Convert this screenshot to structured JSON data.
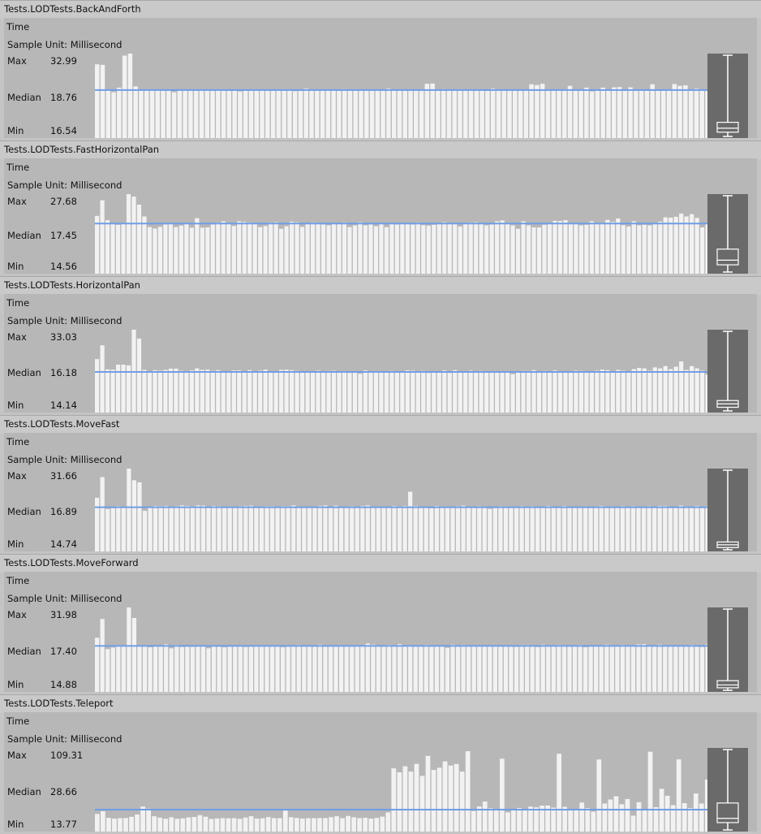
{
  "colors": {
    "bar": "#f2f2f2",
    "median_line": "#6f9ee6",
    "panel": "#b7b7b7",
    "header": "#c9c9c9",
    "boxplot_bg": "#6a6a6a",
    "boxplot_stroke": "#ffffff"
  },
  "tests": [
    {
      "name": "Tests.LODTests.BackAndForth",
      "metric": "Time",
      "sample_unit_label": "Sample Unit: Millisecond",
      "max_label": "Max",
      "max_value": "32.99",
      "median_label": "Median",
      "median_value": "18.76",
      "min_label": "Min",
      "min_value": "16.54"
    },
    {
      "name": "Tests.LODTests.FastHorizontalPan",
      "metric": "Time",
      "sample_unit_label": "Sample Unit: Millisecond",
      "max_label": "Max",
      "max_value": "27.68",
      "median_label": "Median",
      "median_value": "17.45",
      "min_label": "Min",
      "min_value": "14.56"
    },
    {
      "name": "Tests.LODTests.HorizontalPan",
      "metric": "Time",
      "sample_unit_label": "Sample Unit: Millisecond",
      "max_label": "Max",
      "max_value": "33.03",
      "median_label": "Median",
      "median_value": "16.18",
      "min_label": "Min",
      "min_value": "14.14"
    },
    {
      "name": "Tests.LODTests.MoveFast",
      "metric": "Time",
      "sample_unit_label": "Sample Unit: Millisecond",
      "max_label": "Max",
      "max_value": "31.66",
      "median_label": "Median",
      "median_value": "16.89",
      "min_label": "Min",
      "min_value": "14.74"
    },
    {
      "name": "Tests.LODTests.MoveForward",
      "metric": "Time",
      "sample_unit_label": "Sample Unit: Millisecond",
      "max_label": "Max",
      "max_value": "31.98",
      "median_label": "Median",
      "median_value": "17.40",
      "min_label": "Min",
      "min_value": "14.88"
    },
    {
      "name": "Tests.LODTests.Teleport",
      "metric": "Time",
      "sample_unit_label": "Sample Unit: Millisecond",
      "max_label": "Max",
      "max_value": "109.31",
      "median_label": "Median",
      "median_value": "28.66",
      "min_label": "Min",
      "min_value": "13.77"
    }
  ],
  "chart_data": [
    {
      "type": "bar",
      "ylim": [
        0,
        32.99
      ],
      "median": 18.76,
      "min": 16.54,
      "max": 32.99,
      "boxplot": {
        "min": 16.54,
        "q1": 17.4,
        "median": 18.2,
        "q3": 19.4,
        "max": 32.99
      },
      "values": [
        28.8,
        28.6,
        18.8,
        17.9,
        19.7,
        32.2,
        32.99,
        20.2,
        18.7,
        18.6,
        18.8,
        18.6,
        18.6,
        18.6,
        17.9,
        18.7,
        18.6,
        18.8,
        18.6,
        18.8,
        19.0,
        18.5,
        18.6,
        18.9,
        18.4,
        18.7,
        18.2,
        19.0,
        18.6,
        18.8,
        18.9,
        18.6,
        18.5,
        18.8,
        18.9,
        18.8,
        18.3,
        18.7,
        19.3,
        18.6,
        18.6,
        18.8,
        18.6,
        18.7,
        18.4,
        19.1,
        18.6,
        18.9,
        18.6,
        18.8,
        18.6,
        18.8,
        18.6,
        19.3,
        18.5,
        18.6,
        18.9,
        18.8,
        18.6,
        18.8,
        21.2,
        21.3,
        18.5,
        19.1,
        18.6,
        18.8,
        18.6,
        18.8,
        18.7,
        18.9,
        18.6,
        18.4,
        19.3,
        18.7,
        18.6,
        18.8,
        18.6,
        18.8,
        18.7,
        21.0,
        20.7,
        21.2,
        18.5,
        19.0,
        18.8,
        18.8,
        20.4,
        18.6,
        18.7,
        19.7,
        18.2,
        18.8,
        19.7,
        18.6,
        19.8,
        19.9,
        18.8,
        19.8,
        18.6,
        18.8,
        18.4,
        21.0,
        18.5,
        18.8,
        18.6,
        21.1,
        20.4,
        20.6,
        18.8,
        19.3,
        18.6,
        18.5
      ]
    },
    {
      "type": "bar",
      "ylim": [
        0,
        27.68
      ],
      "median": 17.45,
      "min": 14.56,
      "max": 27.68,
      "boxplot": {
        "min": 14.56,
        "q1": 15.8,
        "median": 16.6,
        "q3": 18.5,
        "max": 27.68
      },
      "values": [
        20.1,
        25.5,
        18.6,
        17.5,
        17.0,
        17.3,
        27.68,
        26.8,
        24.0,
        19.9,
        16.2,
        15.7,
        16.3,
        17.1,
        17.6,
        16.2,
        16.7,
        17.2,
        16.0,
        19.3,
        16.0,
        16.1,
        17.1,
        17.8,
        18.2,
        17.2,
        16.6,
        18.2,
        18.0,
        17.8,
        17.6,
        16.2,
        16.6,
        17.8,
        17.9,
        15.6,
        16.5,
        18.1,
        17.9,
        16.3,
        17.3,
        17.8,
        17.7,
        17.1,
        16.8,
        17.4,
        17.6,
        17.8,
        16.2,
        16.8,
        17.9,
        16.8,
        17.1,
        16.5,
        17.6,
        16.2,
        17.7,
        17.1,
        17.6,
        17.3,
        17.1,
        17.8,
        16.9,
        16.7,
        17.0,
        17.5,
        17.9,
        17.3,
        17.4,
        16.4,
        17.5,
        17.8,
        17.9,
        17.3,
        16.8,
        17.1,
        18.2,
        18.5,
        17.6,
        16.8,
        15.6,
        18.2,
        16.8,
        16.1,
        16.1,
        17.0,
        17.5,
        18.4,
        18.3,
        18.6,
        17.3,
        17.5,
        16.8,
        17.0,
        18.2,
        17.6,
        17.7,
        18.7,
        18.0,
        19.2,
        16.9,
        16.4,
        18.2,
        16.8,
        17.0,
        16.8,
        17.2,
        18.1,
        19.6,
        19.5,
        19.8,
        20.9,
        19.9,
        20.7,
        19.4,
        16.1,
        17.5
      ]
    },
    {
      "type": "bar",
      "ylim": [
        0,
        33.03
      ],
      "median": 16.18,
      "min": 14.14,
      "max": 33.03,
      "boxplot": {
        "min": 14.14,
        "q1": 15.0,
        "median": 15.8,
        "q3": 16.6,
        "max": 33.03
      },
      "values": [
        21.3,
        26.8,
        17.2,
        17.1,
        19.1,
        19.1,
        18.8,
        33.03,
        29.5,
        17.0,
        16.3,
        16.9,
        16.7,
        17.0,
        17.5,
        17.5,
        16.7,
        16.3,
        16.8,
        17.6,
        17.0,
        17.1,
        16.6,
        16.9,
        16.4,
        16.1,
        16.8,
        16.8,
        16.4,
        16.9,
        15.9,
        16.7,
        17.1,
        16.4,
        16.4,
        17.0,
        17.1,
        16.9,
        16.6,
        16.4,
        16.1,
        16.2,
        16.7,
        16.3,
        16.6,
        16.7,
        16.2,
        16.0,
        15.8,
        15.9,
        15.5,
        16.8,
        16.1,
        16.2,
        15.9,
        16.5,
        16.6,
        16.3,
        16.4,
        16.8,
        16.7,
        16.4,
        16.6,
        15.8,
        16.3,
        16.4,
        16.8,
        15.8,
        16.9,
        15.9,
        16.4,
        16.7,
        16.3,
        16.6,
        16.4,
        16.3,
        16.2,
        16.0,
        15.9,
        15.3,
        16.2,
        16.6,
        16.6,
        16.9,
        15.9,
        16.6,
        16.2,
        16.8,
        16.5,
        16.3,
        16.5,
        16.7,
        16.6,
        16.3,
        16.2,
        16.7,
        17.1,
        16.9,
        16.1,
        17.0,
        16.7,
        15.9,
        17.3,
        17.8,
        17.6,
        16.7,
        18.0,
        17.6,
        18.5,
        17.3,
        18.3,
        20.4,
        17.0,
        18.5,
        17.6,
        16.7,
        15.1
      ]
    },
    {
      "type": "bar",
      "ylim": [
        0,
        31.66
      ],
      "median": 16.89,
      "min": 14.74,
      "max": 31.66,
      "boxplot": {
        "min": 14.74,
        "q1": 15.2,
        "median": 15.8,
        "q3": 16.4,
        "max": 31.66
      },
      "values": [
        20.5,
        28.4,
        16.2,
        16.5,
        17.3,
        17.1,
        31.66,
        27.2,
        26.4,
        15.5,
        16.8,
        17.4,
        17.3,
        17.4,
        16.6,
        17.3,
        17.6,
        17.4,
        17.2,
        17.6,
        17.5,
        17.0,
        17.4,
        17.3,
        16.7,
        17.2,
        17.1,
        17.3,
        17.4,
        17.5,
        16.8,
        17.2,
        17.3,
        17.3,
        17.1,
        17.3,
        17.3,
        17.6,
        17.2,
        16.8,
        16.8,
        17.1,
        17.4,
        17.6,
        16.8,
        17.5,
        17.0,
        17.2,
        17.3,
        16.9,
        17.4,
        17.6,
        17.1,
        17.1,
        16.8,
        16.7,
        17.4,
        17.2,
        17.4,
        22.8,
        17.4,
        16.9,
        17.0,
        16.5,
        17.4,
        17.2,
        17.2,
        17.0,
        17.3,
        17.5,
        16.7,
        16.8,
        17.3,
        17.1,
        16.3,
        16.8,
        17.3,
        17.2,
        16.8,
        17.1,
        17.3,
        16.7,
        17.3,
        17.1,
        16.7,
        17.4,
        16.8,
        17.1,
        17.4,
        17.0,
        16.9,
        16.8,
        17.2,
        16.8,
        17.2,
        17.4,
        17.1,
        17.2,
        16.8,
        17.3,
        16.9,
        17.3,
        17.0,
        16.8,
        17.3,
        16.9,
        17.4,
        17.4,
        16.6,
        17.1,
        17.5,
        17.2,
        17.0,
        17.4,
        17.1,
        17.3
      ]
    },
    {
      "type": "bar",
      "ylim": [
        0,
        31.98
      ],
      "median": 17.4,
      "min": 14.88,
      "max": 31.98,
      "boxplot": {
        "min": 14.88,
        "q1": 15.4,
        "median": 16.0,
        "q3": 16.9,
        "max": 31.98
      },
      "values": [
        20.5,
        27.6,
        16.2,
        16.8,
        17.3,
        17.5,
        31.98,
        28.0,
        17.5,
        17.5,
        16.9,
        17.2,
        17.3,
        18.0,
        16.5,
        17.8,
        17.0,
        17.2,
        17.1,
        17.4,
        17.3,
        16.5,
        17.7,
        17.2,
        16.9,
        17.6,
        17.6,
        17.5,
        17.0,
        17.2,
        17.7,
        17.2,
        17.4,
        17.3,
        17.5,
        16.9,
        17.6,
        17.6,
        17.8,
        17.2,
        17.4,
        17.3,
        17.9,
        17.2,
        17.3,
        17.6,
        17.4,
        17.7,
        17.4,
        17.7,
        17.6,
        18.3,
        17.9,
        17.5,
        17.1,
        17.8,
        17.3,
        18.1,
        17.4,
        17.6,
        17.5,
        17.3,
        17.8,
        17.2,
        17.5,
        17.6,
        16.7,
        17.9,
        17.4,
        17.8,
        17.3,
        17.5,
        17.6,
        17.3,
        17.6,
        17.7,
        17.5,
        17.2,
        17.6,
        17.1,
        17.8,
        17.8,
        17.2,
        17.0,
        17.9,
        17.4,
        17.3,
        17.8,
        17.7,
        17.2,
        17.4,
        17.8,
        16.9,
        17.5,
        17.6,
        17.7,
        17.9,
        17.5,
        17.2,
        17.8,
        17.4,
        17.6,
        18.0,
        18.1,
        17.5,
        17.4,
        17.9,
        17.5,
        17.2,
        17.3,
        17.5,
        17.6,
        17.8,
        17.3,
        17.0,
        18.0
      ]
    },
    {
      "type": "bar",
      "ylim": [
        0,
        109.31
      ],
      "median": 28.66,
      "min": 13.77,
      "max": 109.31,
      "boxplot": {
        "min": 13.77,
        "q1": 22.5,
        "median": 27.5,
        "q3": 45.8,
        "max": 109.31
      },
      "values": [
        23.0,
        26.5,
        17.9,
        17.0,
        17.5,
        17.7,
        19.3,
        22.3,
        32.6,
        30.0,
        20.0,
        18.2,
        16.8,
        18.7,
        16.8,
        17.3,
        18.6,
        19.1,
        21.4,
        19.4,
        16.5,
        17.2,
        17.5,
        17.4,
        17.5,
        16.6,
        18.3,
        20.0,
        17.0,
        17.4,
        19.0,
        17.6,
        17.5,
        27.4,
        18.7,
        17.8,
        17.1,
        17.5,
        17.5,
        17.6,
        17.7,
        18.8,
        20.0,
        17.5,
        20.4,
        18.7,
        17.6,
        18.0,
        17.0,
        17.8,
        19.5,
        25.0,
        82.6,
        77.4,
        85.3,
        78.4,
        88.5,
        72.8,
        98.9,
        80.5,
        83.4,
        91.7,
        86.3,
        88.3,
        78.4,
        105.0,
        26.9,
        32.8,
        39.2,
        30.4,
        28.8,
        95.2,
        25.1,
        29.5,
        30.8,
        29.3,
        32.6,
        31.6,
        33.9,
        34.0,
        31.3,
        101.7,
        32.3,
        29.3,
        29.0,
        37.9,
        30.5,
        26.0,
        94.2,
        36.6,
        41.9,
        46.2,
        35.7,
        42.5,
        20.8,
        38.4,
        29.6,
        104.4,
        31.8,
        55.9,
        46.8,
        34.5,
        94.4,
        37.1,
        30.6,
        49.8,
        36.6,
        68.0
      ]
    }
  ]
}
